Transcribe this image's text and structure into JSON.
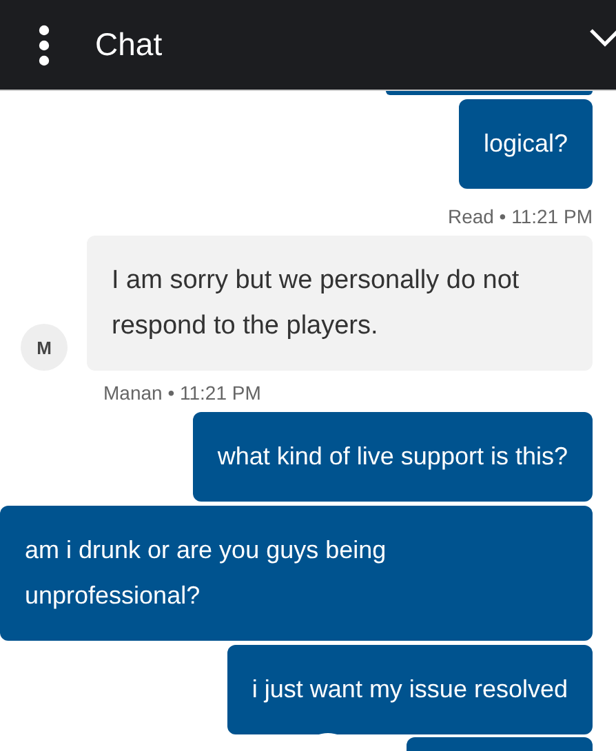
{
  "header": {
    "title": "Chat"
  },
  "messages": [
    {
      "kind": "user",
      "text": "logical?",
      "meta": "Read • 11:21 PM"
    },
    {
      "kind": "agent",
      "text": "I am sorry but we personally do not respond to the players.",
      "avatar": "M",
      "meta": "Manan • 11:21 PM"
    },
    {
      "kind": "user",
      "text": "what kind of live support is this?"
    },
    {
      "kind": "user",
      "text": "am i drunk or are you guys being unprofessional?"
    },
    {
      "kind": "user",
      "text": "i just want my issue resolved"
    }
  ]
}
